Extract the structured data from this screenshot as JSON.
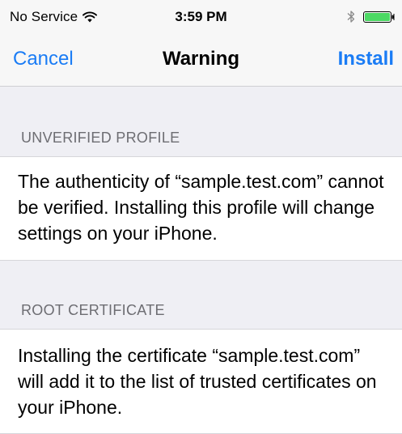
{
  "status_bar": {
    "carrier": "No Service",
    "time": "3:59 PM",
    "wifi_icon": "wifi-icon",
    "bluetooth_icon": "bluetooth-icon",
    "battery_icon": "battery-icon",
    "battery_color": "#4cd964"
  },
  "nav": {
    "cancel_label": "Cancel",
    "title": "Warning",
    "install_label": "Install",
    "accent_color": "#1a7cf5"
  },
  "sections": [
    {
      "header": "UNVERIFIED PROFILE",
      "body": "The authenticity of “sample.test.com” cannot be verified. Installing this profile will change settings on your iPhone."
    },
    {
      "header": "ROOT CERTIFICATE",
      "body": "Installing the certificate “sample.test.com” will add it to the list of trusted certificates on your iPhone."
    }
  ]
}
